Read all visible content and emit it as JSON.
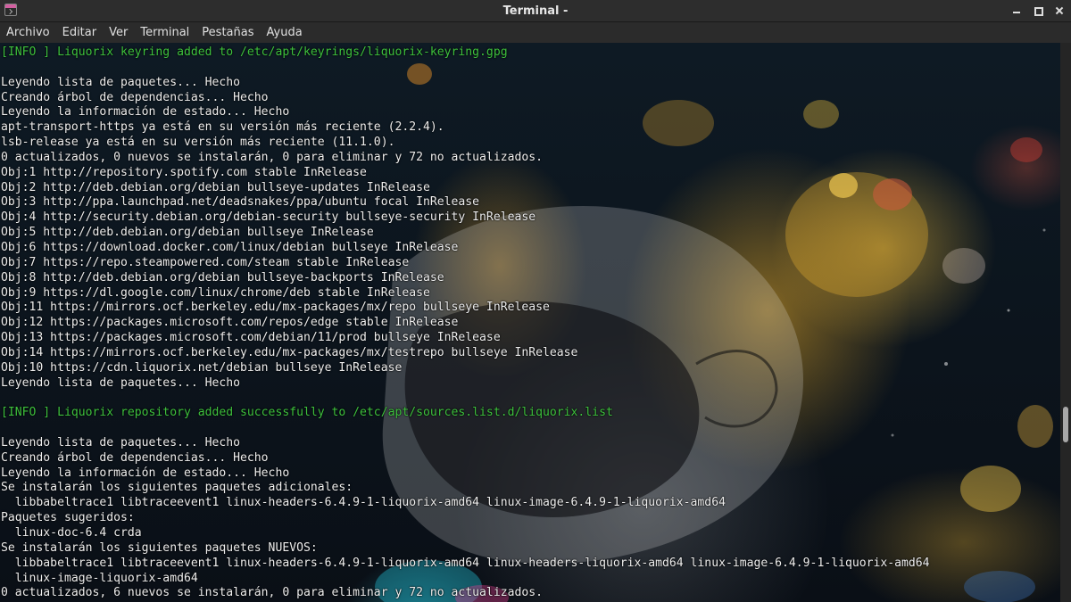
{
  "window": {
    "title": "Terminal -"
  },
  "menu": [
    "Archivo",
    "Editar",
    "Ver",
    "Terminal",
    "Pestañas",
    "Ayuda"
  ],
  "colors": {
    "info_green": "#3ec23e",
    "text": "#eeeeee",
    "background": "#0d1117"
  },
  "terminal": {
    "lines": [
      {
        "text": "[INFO ] Liquorix keyring added to /etc/apt/keyrings/liquorix-keyring.gpg",
        "style": "info"
      },
      {
        "text": "",
        "style": "normal"
      },
      {
        "text": "Leyendo lista de paquetes... Hecho",
        "style": "normal"
      },
      {
        "text": "Creando árbol de dependencias... Hecho",
        "style": "normal"
      },
      {
        "text": "Leyendo la información de estado... Hecho",
        "style": "normal"
      },
      {
        "text": "apt-transport-https ya está en su versión más reciente (2.2.4).",
        "style": "normal"
      },
      {
        "text": "lsb-release ya está en su versión más reciente (11.1.0).",
        "style": "normal"
      },
      {
        "text": "0 actualizados, 0 nuevos se instalarán, 0 para eliminar y 72 no actualizados.",
        "style": "normal"
      },
      {
        "text": "Obj:1 http://repository.spotify.com stable InRelease",
        "style": "normal"
      },
      {
        "text": "Obj:2 http://deb.debian.org/debian bullseye-updates InRelease",
        "style": "normal"
      },
      {
        "text": "Obj:3 http://ppa.launchpad.net/deadsnakes/ppa/ubuntu focal InRelease",
        "style": "normal"
      },
      {
        "text": "Obj:4 http://security.debian.org/debian-security bullseye-security InRelease",
        "style": "normal"
      },
      {
        "text": "Obj:5 http://deb.debian.org/debian bullseye InRelease",
        "style": "normal"
      },
      {
        "text": "Obj:6 https://download.docker.com/linux/debian bullseye InRelease",
        "style": "normal"
      },
      {
        "text": "Obj:7 https://repo.steampowered.com/steam stable InRelease",
        "style": "normal"
      },
      {
        "text": "Obj:8 http://deb.debian.org/debian bullseye-backports InRelease",
        "style": "normal"
      },
      {
        "text": "Obj:9 https://dl.google.com/linux/chrome/deb stable InRelease",
        "style": "normal"
      },
      {
        "text": "Obj:11 https://mirrors.ocf.berkeley.edu/mx-packages/mx/repo bullseye InRelease",
        "style": "normal"
      },
      {
        "text": "Obj:12 https://packages.microsoft.com/repos/edge stable InRelease",
        "style": "normal"
      },
      {
        "text": "Obj:13 https://packages.microsoft.com/debian/11/prod bullseye InRelease",
        "style": "normal"
      },
      {
        "text": "Obj:14 https://mirrors.ocf.berkeley.edu/mx-packages/mx/testrepo bullseye InRelease",
        "style": "normal"
      },
      {
        "text": "Obj:10 https://cdn.liquorix.net/debian bullseye InRelease",
        "style": "normal"
      },
      {
        "text": "Leyendo lista de paquetes... Hecho",
        "style": "normal"
      },
      {
        "text": "",
        "style": "normal"
      },
      {
        "text": "[INFO ] Liquorix repository added successfully to /etc/apt/sources.list.d/liquorix.list",
        "style": "info"
      },
      {
        "text": "",
        "style": "normal"
      },
      {
        "text": "Leyendo lista de paquetes... Hecho",
        "style": "normal"
      },
      {
        "text": "Creando árbol de dependencias... Hecho",
        "style": "normal"
      },
      {
        "text": "Leyendo la información de estado... Hecho",
        "style": "normal"
      },
      {
        "text": "Se instalarán los siguientes paquetes adicionales:",
        "style": "normal"
      },
      {
        "text": "  libbabeltrace1 libtraceevent1 linux-headers-6.4.9-1-liquorix-amd64 linux-image-6.4.9-1-liquorix-amd64",
        "style": "normal"
      },
      {
        "text": "Paquetes sugeridos:",
        "style": "normal"
      },
      {
        "text": "  linux-doc-6.4 crda",
        "style": "normal"
      },
      {
        "text": "Se instalarán los siguientes paquetes NUEVOS:",
        "style": "normal"
      },
      {
        "text": "  libbabeltrace1 libtraceevent1 linux-headers-6.4.9-1-liquorix-amd64 linux-headers-liquorix-amd64 linux-image-6.4.9-1-liquorix-amd64",
        "style": "normal"
      },
      {
        "text": "  linux-image-liquorix-amd64",
        "style": "normal"
      },
      {
        "text": "0 actualizados, 6 nuevos se instalarán, 0 para eliminar y 72 no actualizados.",
        "style": "normal"
      }
    ]
  }
}
